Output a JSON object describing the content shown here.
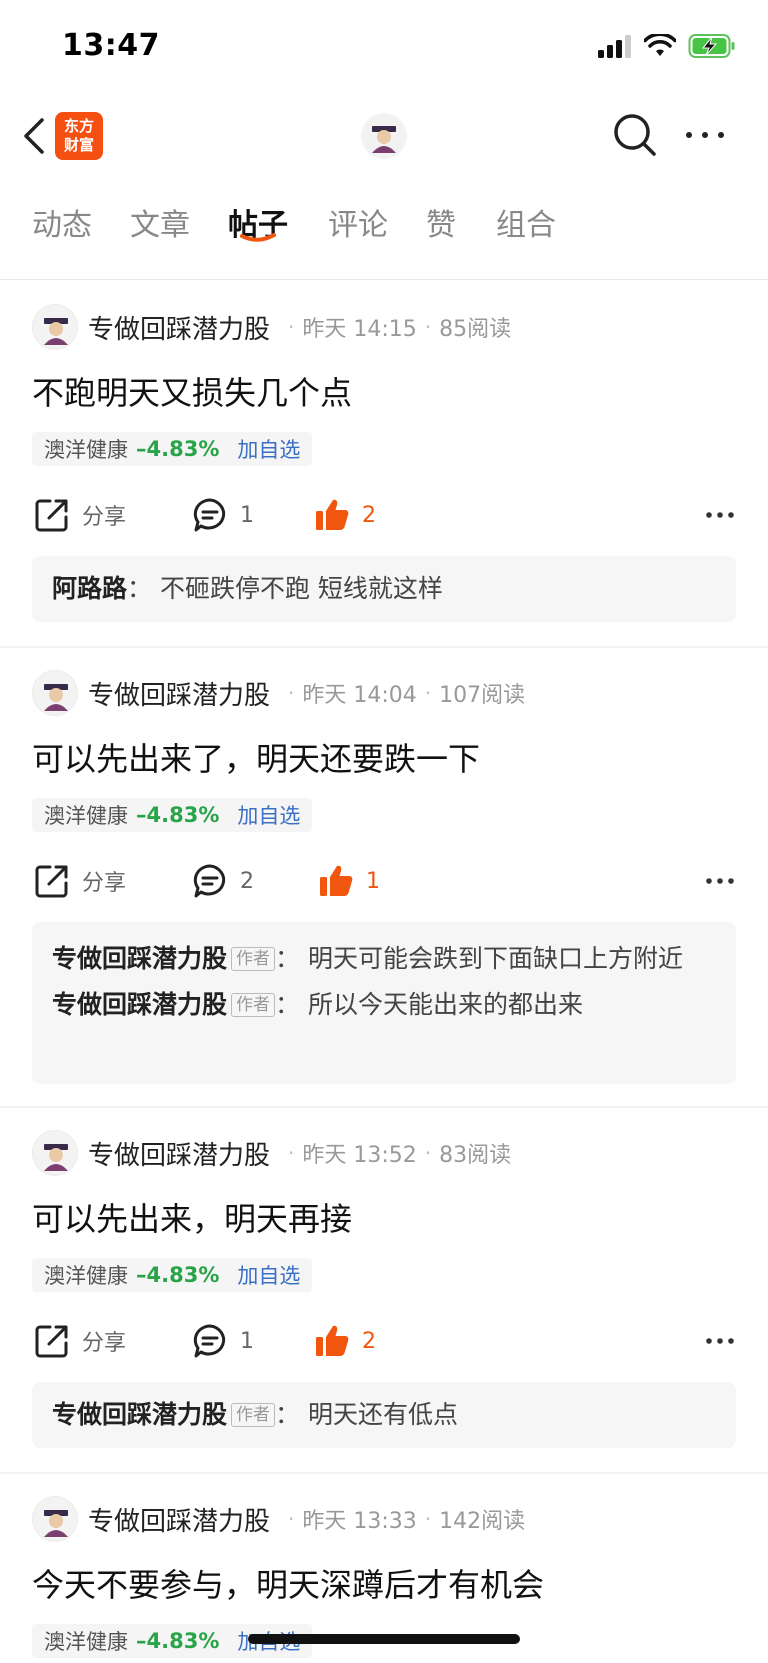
{
  "status_bar": {
    "time": "13:47"
  },
  "nav": {
    "brand_line1": "东方",
    "brand_line2": "财富"
  },
  "tabs": [
    {
      "label": "动态"
    },
    {
      "label": "文章"
    },
    {
      "label": "帖子",
      "active": true
    },
    {
      "label": "评论"
    },
    {
      "label": "赞"
    },
    {
      "label": "组合"
    }
  ],
  "colors": {
    "accent": "#f0560e",
    "up_green": "#29a347",
    "link_blue": "#3a6fc4"
  },
  "posts": [
    {
      "author": "专做回踩潜力股",
      "time": "昨天 14:15",
      "reads": "85阅读",
      "title": "不跑明天又损失几个点",
      "stock": {
        "name": "澳洋健康",
        "change": "–4.83%",
        "add": "加自选"
      },
      "share_label": "分享",
      "comments": "1",
      "likes": "2",
      "replies": [
        {
          "user": "阿路路",
          "is_author": false,
          "sep": "：",
          "text": "不砸跌停不跑  短线就这样"
        }
      ]
    },
    {
      "author": "专做回踩潜力股",
      "time": "昨天 14:04",
      "reads": "107阅读",
      "title": "可以先出来了，明天还要跌一下",
      "stock": {
        "name": "澳洋健康",
        "change": "–4.83%",
        "add": "加自选"
      },
      "share_label": "分享",
      "comments": "2",
      "likes": "1",
      "replies": [
        {
          "user": "专做回踩潜力股",
          "is_author": true,
          "badge": "作者",
          "sep": "：",
          "text": "明天可能会跌到下面缺口上方附近"
        },
        {
          "user": "专做回踩潜力股",
          "is_author": true,
          "badge": "作者",
          "sep": "：",
          "text": "所以今天能出来的都出来"
        }
      ]
    },
    {
      "author": "专做回踩潜力股",
      "time": "昨天 13:52",
      "reads": "83阅读",
      "title": "可以先出来，明天再接",
      "stock": {
        "name": "澳洋健康",
        "change": "–4.83%",
        "add": "加自选"
      },
      "share_label": "分享",
      "comments": "1",
      "likes": "2",
      "replies": [
        {
          "user": "专做回踩潜力股",
          "is_author": true,
          "badge": "作者",
          "sep": "：",
          "text": "明天还有低点"
        }
      ]
    },
    {
      "author": "专做回踩潜力股",
      "time": "昨天 13:33",
      "reads": "142阅读",
      "title": "今天不要参与，明天深蹲后才有机会",
      "stock": {
        "name": "澳洋健康",
        "change": "–4.83%",
        "add": "加自选"
      }
    }
  ]
}
